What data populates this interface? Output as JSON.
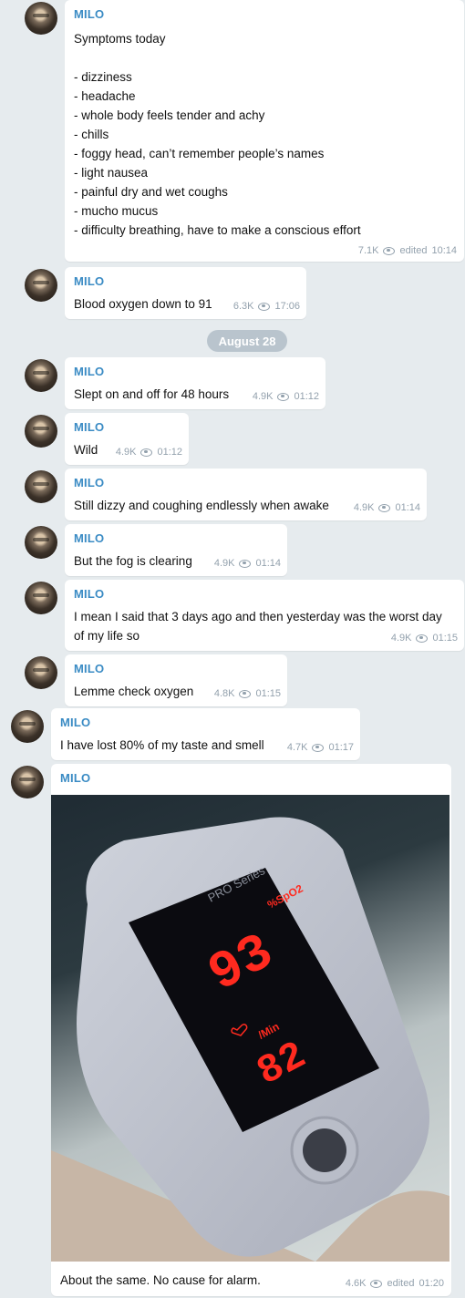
{
  "messages": [
    {
      "sender": "MILO",
      "text": "Symptoms today\n\n- dizziness\n- headache\n- whole body feels tender and achy\n- chills\n- foggy head, can’t remember people’s names\n- light nausea\n- painful dry and wet coughs\n- mucho mucus\n- difficulty breathing, have to make a conscious effort",
      "views": "7.1K",
      "edited": "edited",
      "time": "10:14"
    },
    {
      "sender": "MILO",
      "text": "Blood oxygen down to 91",
      "views": "6.3K",
      "time": "17:06"
    },
    {
      "sender": "MILO",
      "text": "Slept on and off for 48 hours",
      "views": "4.9K",
      "time": "01:12"
    },
    {
      "sender": "MILO",
      "text": "Wild",
      "views": "4.9K",
      "time": "01:12"
    },
    {
      "sender": "MILO",
      "text": "Still dizzy and coughing endlessly when awake",
      "views": "4.9K",
      "time": "01:14"
    },
    {
      "sender": "MILO",
      "text": "But the fog is clearing",
      "views": "4.9K",
      "time": "01:14"
    },
    {
      "sender": "MILO",
      "text": "I mean I said that 3 days ago and then yesterday was the worst day\nof my life so",
      "views": "4.9K",
      "time": "01:15"
    },
    {
      "sender": "MILO",
      "text": "Lemme check oxygen",
      "views": "4.8K",
      "time": "01:15"
    },
    {
      "sender": "MILO",
      "text": "I have lost 80% of my taste and smell",
      "views": "4.7K",
      "time": "01:17"
    },
    {
      "sender": "MILO",
      "text": "About the same. No cause for alarm.",
      "views": "4.6K",
      "edited": "edited",
      "time": "01:20",
      "photo": {
        "brand": "PRO Series",
        "spo2_label": "%SpO2",
        "spo2_value": "93",
        "pulse_label": "/Min",
        "pulse_value": "82"
      }
    }
  ],
  "date_separator": "August 28",
  "icons": {
    "views": "eye-icon",
    "pulse": "heart-icon"
  },
  "colors": {
    "sender": "#3a8bc4",
    "background": "#e6ebee",
    "meta": "#93a1ad",
    "led": "#ff2a1f"
  }
}
